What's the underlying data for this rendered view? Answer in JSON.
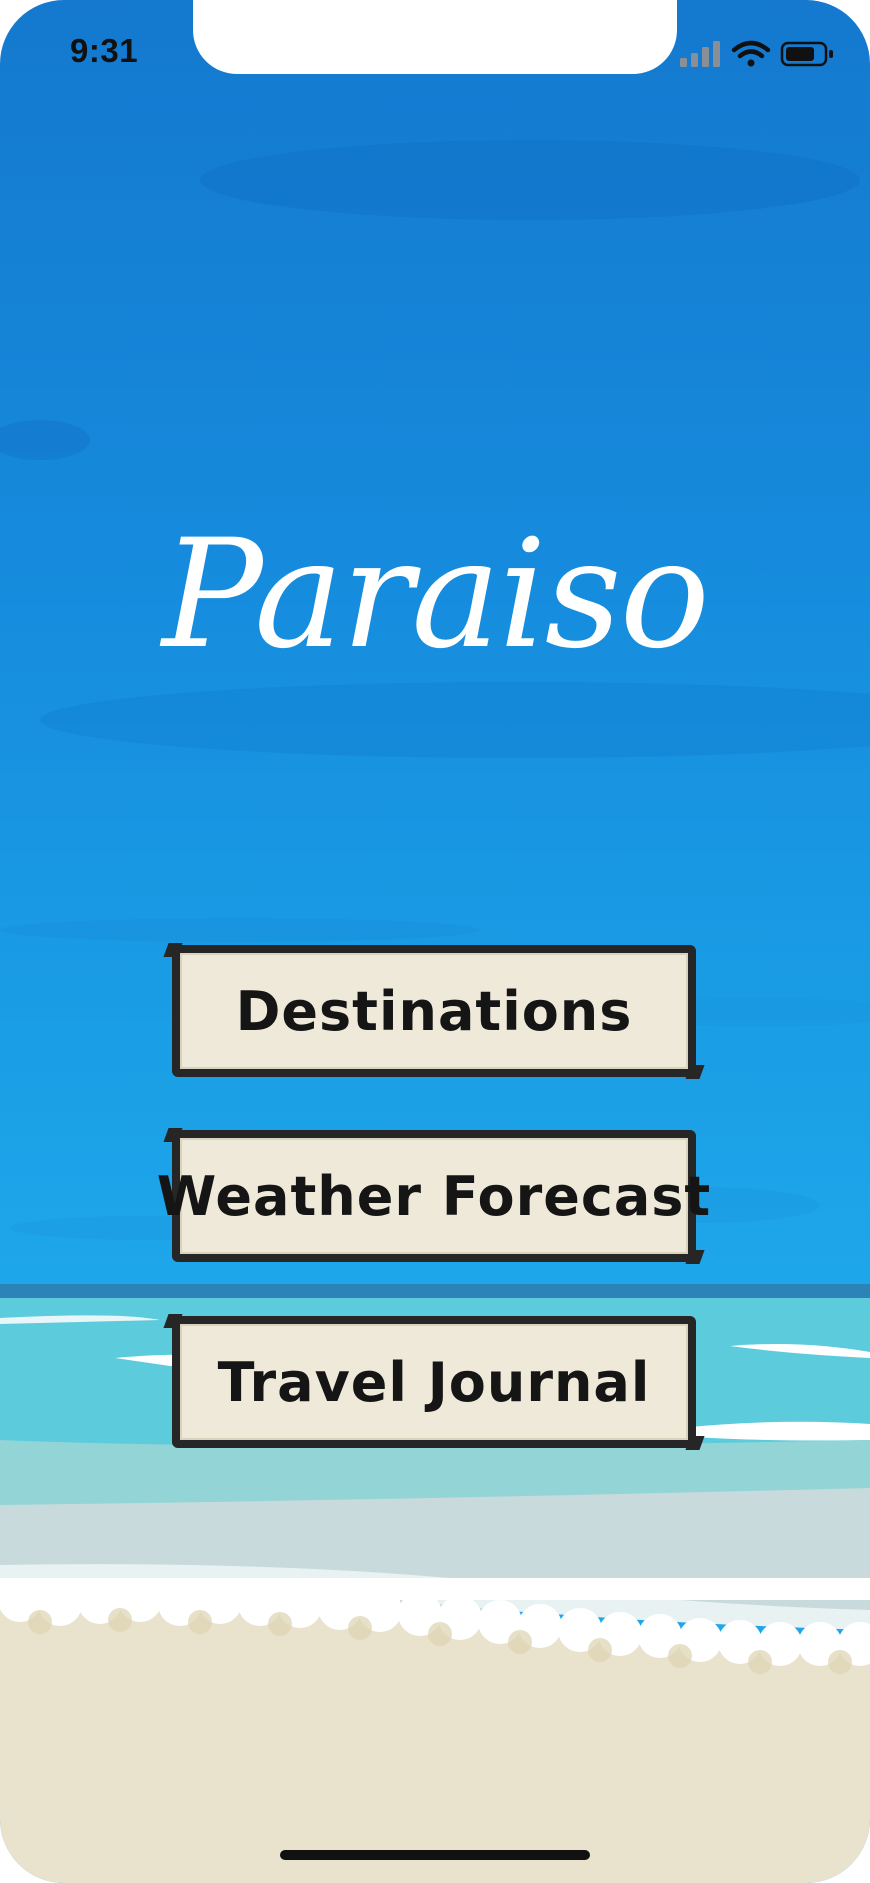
{
  "status_bar": {
    "time": "9:31",
    "signal_icon": "cellular-signal-icon",
    "wifi_icon": "wifi-icon",
    "battery_icon": "battery-icon"
  },
  "app": {
    "title": "Paraiso"
  },
  "menu": {
    "destinations_label": "Destinations",
    "weather_label": "Weather Forecast",
    "journal_label": "Travel Journal"
  },
  "colors": {
    "sky_top": "#1479cf",
    "sky_bottom": "#1ea6ea",
    "sea": "#5ccbdc",
    "sand": "#e9e2cd",
    "button_fill": "#efe9d9",
    "button_border": "#262626"
  }
}
